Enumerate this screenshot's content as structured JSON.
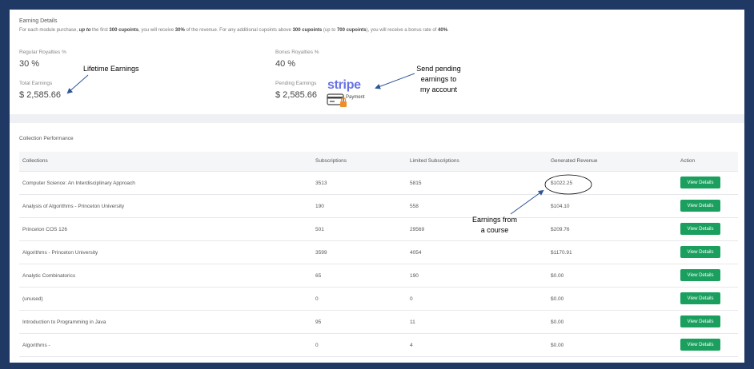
{
  "earning_details": {
    "title": "Earning Details",
    "desc": {
      "p1": "For each module purchase, ",
      "b1": "up to",
      "p2": " the first ",
      "b2": "300 cupoints",
      "p3": ", you will receive ",
      "b3": "30%",
      "p4": " of the revenue. For any additional cupoints above ",
      "b4": "300 cupoints",
      "p5": " (up to ",
      "b5": "700 cupoints",
      "p6": "), you will receive a bonus rate of ",
      "b6": "40%",
      "p7": "."
    },
    "regular_label": "Regular Royalties %",
    "regular_value": "30 %",
    "bonus_label": "Bonus Royalties %",
    "bonus_value": "40 %",
    "total_label": "Total Earnings",
    "total_value": "$ 2,585.66",
    "pending_label": "Pending Earnings",
    "pending_value": "$ 2,585.66",
    "stripe_logo": "stripe",
    "payment_label": "Payment"
  },
  "annotations": {
    "lifetime": "Lifetime Earnings",
    "send_pending": [
      "Send pending",
      "earnings to",
      "my account"
    ],
    "earnings_course": [
      "Earnings from",
      "a course"
    ]
  },
  "performance": {
    "title": "Collection Performance",
    "headers": [
      "Collections",
      "Subscriptions",
      "Limited Subscriptions",
      "Generated Revenue",
      "Action"
    ],
    "rows": [
      {
        "name": "Computer Science: An Interdisciplinary Approach",
        "subs": "3513",
        "limited": "5815",
        "revenue": "$1022.25",
        "action": "View Details"
      },
      {
        "name": "Analysis of Algorithms - Princeton University",
        "subs": "190",
        "limited": "558",
        "revenue": "$104.10",
        "action": "View Details"
      },
      {
        "name": "Princeton COS 126",
        "subs": "501",
        "limited": "29569",
        "revenue": "$209.76",
        "action": "View Details"
      },
      {
        "name": "Algorithms - Princeton University",
        "subs": "3599",
        "limited": "4054",
        "revenue": "$1170.91",
        "action": "View Details"
      },
      {
        "name": "Analytic Combinatorics",
        "subs": "65",
        "limited": "190",
        "revenue": "$0.00",
        "action": "View Details"
      },
      {
        "name": "(unused)",
        "subs": "0",
        "limited": "0",
        "revenue": "$0.00",
        "action": "View Details"
      },
      {
        "name": "Introduction to Programming in Java",
        "subs": "95",
        "limited": "11",
        "revenue": "$0.00",
        "action": "View Details"
      },
      {
        "name": "Algorithms -",
        "subs": "0",
        "limited": "4",
        "revenue": "$0.00",
        "action": "View Details"
      }
    ]
  },
  "colors": {
    "frame": "#1f3864",
    "stripe": "#6772e5",
    "button": "#1a9f5e",
    "arrow": "#2e5597"
  },
  "icons": {
    "payment": "credit-card-lock-icon"
  }
}
